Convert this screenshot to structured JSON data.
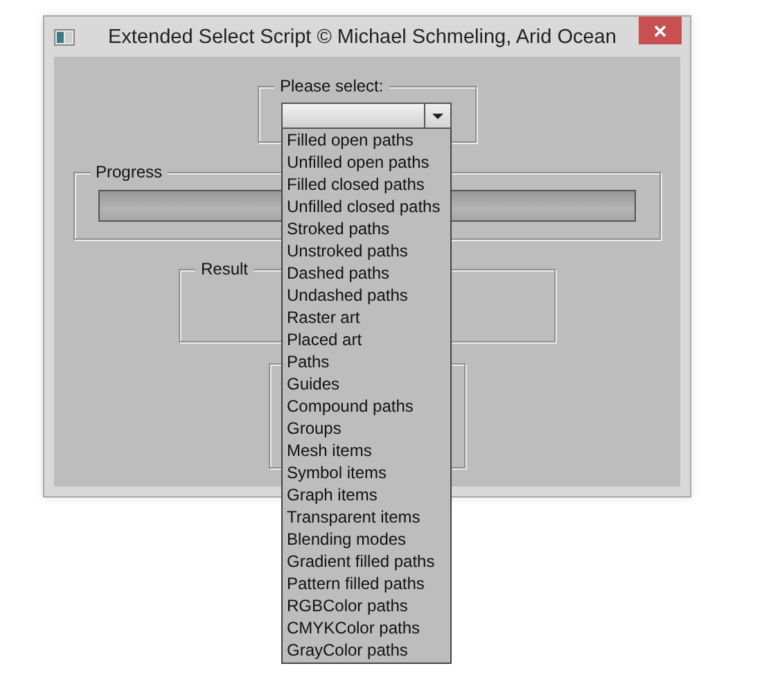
{
  "window": {
    "title": "Extended Select Script © Michael Schmeling, Arid Ocean"
  },
  "select_group": {
    "label": "Please select:",
    "dropdown": {
      "expanded": true,
      "options": [
        {
          "label": "Filled open paths",
          "selected": false
        },
        {
          "label": "Unfilled open paths",
          "selected": false
        },
        {
          "label": "Filled closed paths",
          "selected": false
        },
        {
          "label": "Unfilled closed paths",
          "selected": false
        },
        {
          "label": "Stroked paths",
          "selected": false
        },
        {
          "label": "Unstroked paths",
          "selected": false
        },
        {
          "label": "Dashed paths",
          "selected": false
        },
        {
          "label": "Undashed paths",
          "selected": false
        },
        {
          "label": "Raster art",
          "selected": false
        },
        {
          "label": "Placed art",
          "selected": false
        },
        {
          "label": "Paths",
          "selected": false
        },
        {
          "label": "Guides",
          "selected": false
        },
        {
          "label": "Compound paths",
          "selected": false
        },
        {
          "label": "Groups",
          "selected": false
        },
        {
          "label": "Mesh items",
          "selected": false
        },
        {
          "label": "Symbol items",
          "selected": false
        },
        {
          "label": "Graph items",
          "selected": false
        },
        {
          "label": "Transparent items",
          "selected": false
        },
        {
          "label": "Blending modes",
          "selected": false
        },
        {
          "label": "Gradient filled paths",
          "selected": false
        },
        {
          "label": "Pattern filled paths",
          "selected": false
        },
        {
          "label": "RGBColor paths",
          "selected": false
        },
        {
          "label": "CMYKColor paths",
          "selected": false
        },
        {
          "label": "GrayColor paths",
          "selected": false
        }
      ]
    }
  },
  "progress": {
    "label": "Progress",
    "level": 0
  },
  "result": {
    "label": "Result"
  }
}
